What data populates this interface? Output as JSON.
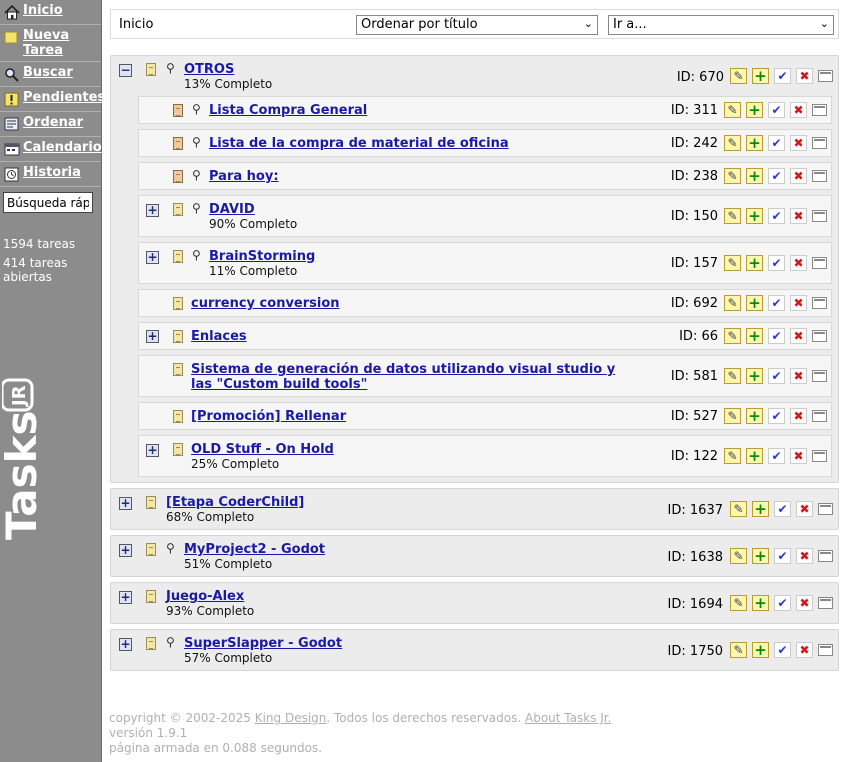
{
  "sidebar": {
    "items": [
      {
        "label": "Inicio",
        "icon": "home-icon"
      },
      {
        "label": "Nueva Tarea",
        "icon": "new-note-icon"
      },
      {
        "label": "Buscar",
        "icon": "magnifier-icon"
      },
      {
        "label": "Pendientes",
        "icon": "warning-icon"
      },
      {
        "label": "Ordenar",
        "icon": "sort-icon"
      },
      {
        "label": "Calendario",
        "icon": "calendar-icon"
      },
      {
        "label": "Historia",
        "icon": "history-icon"
      }
    ],
    "quick_search_value": "Búsqueda ráp",
    "stats_total": "1594 tareas",
    "stats_open": "414 tareas abiertas",
    "logo_text": "Tasks JR"
  },
  "topbar": {
    "breadcrumb": "Inicio",
    "order_select": "Ordenar por título",
    "goto_select": "Ir a..."
  },
  "tasks": [
    {
      "title": "OTROS",
      "progress": "13% Completo",
      "id": "ID: 670",
      "children": [
        {
          "title": "Lista Compra General",
          "id": "ID: 311"
        },
        {
          "title": "Lista de la compra de material de oficina",
          "id": "ID: 242"
        },
        {
          "title": "Para hoy:",
          "id": "ID: 238"
        },
        {
          "title": "DAVID",
          "progress": "90% Completo",
          "id": "ID: 150"
        },
        {
          "title": "BrainStorming",
          "progress": "11% Completo",
          "id": "ID: 157"
        },
        {
          "title": "currency conversion",
          "id": "ID: 692"
        },
        {
          "title": "Enlaces",
          "id": "ID: 66"
        },
        {
          "title": "Sistema de generación de datos utilizando visual studio y las \"Custom build tools\"",
          "id": "ID: 581"
        },
        {
          "title": "[Promoción] Rellenar",
          "id": "ID: 527"
        },
        {
          "title": "OLD Stuff - On Hold",
          "progress": "25% Completo",
          "id": "ID: 122"
        }
      ]
    },
    {
      "title": "[Etapa CoderChild]",
      "progress": "68% Completo",
      "id": "ID: 1637"
    },
    {
      "title": "MyProject2 - Godot",
      "progress": "51% Completo",
      "id": "ID: 1638"
    },
    {
      "title": "Juego-Alex",
      "progress": "93% Completo",
      "id": "ID: 1694"
    },
    {
      "title": "SuperSlapper - Godot",
      "progress": "57% Completo",
      "id": "ID: 1750"
    }
  ],
  "footer": {
    "copyright_prefix": "copyright © 2002-2025 ",
    "company": "King Design",
    "rights": ". Todos los derechos reservados. ",
    "about": "About Tasks Jr.",
    "version": "versión 1.9.1",
    "timing": "página armada en 0.088 segundos."
  },
  "colors": {
    "sidebar_bg": "#8c8c8c",
    "link": "#1a1aa6",
    "panel_bg": "#ececec"
  }
}
